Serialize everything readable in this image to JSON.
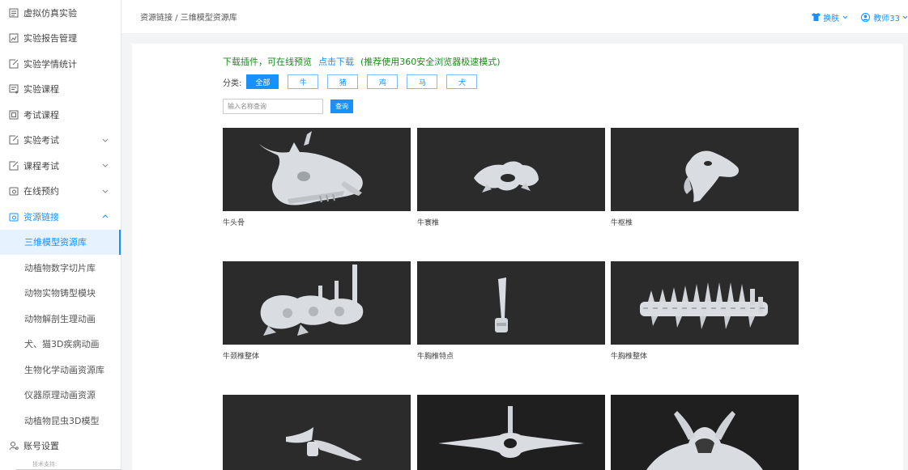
{
  "sidebar": {
    "items": [
      {
        "label": "虚拟仿真实验",
        "icon": "list-icon"
      },
      {
        "label": "实验报告管理",
        "icon": "report-icon"
      },
      {
        "label": "实验学情统计",
        "icon": "edit-icon"
      },
      {
        "label": "实验课程",
        "icon": "course-icon"
      },
      {
        "label": "考试课程",
        "icon": "exam-icon"
      },
      {
        "label": "实验考试",
        "icon": "edit-icon",
        "expandable": true
      },
      {
        "label": "课程考试",
        "icon": "edit-icon",
        "expandable": true
      },
      {
        "label": "在线预约",
        "icon": "calendar-icon",
        "expandable": true
      },
      {
        "label": "资源链接",
        "icon": "link-icon",
        "expandable": true,
        "open": true
      }
    ],
    "sub_items": [
      {
        "label": "三维模型资源库",
        "active": true
      },
      {
        "label": "动植物数字切片库"
      },
      {
        "label": "动物实物铸型模块"
      },
      {
        "label": "动物解剖生理动画"
      },
      {
        "label": "犬、猫3D疾病动画"
      },
      {
        "label": "生物化学动画资源库"
      },
      {
        "label": "仪器原理动画资源"
      },
      {
        "label": "动植物昆虫3D模型"
      }
    ],
    "account": "账号设置",
    "footer_note": "技术支持:"
  },
  "header": {
    "breadcrumb": "资源链接 / 三维模型资源库",
    "skin_label": "换肤",
    "user_label": "教师33"
  },
  "main": {
    "notice_text": "下载插件，可在线预览",
    "notice_link": "点击下载",
    "notice_tip": "(推荐使用360安全浏览器极速模式)",
    "filter_label": "分类:",
    "categories": [
      "全部",
      "牛",
      "猪",
      "鸡",
      "马",
      "犬"
    ],
    "active_category": "全部",
    "search_placeholder": "输入名称查询",
    "search_button": "查询",
    "models": [
      {
        "name": "牛头骨"
      },
      {
        "name": "牛寰椎"
      },
      {
        "name": "牛枢椎"
      },
      {
        "name": "牛颈椎整体"
      },
      {
        "name": "牛胸椎特点"
      },
      {
        "name": "牛胸椎整体"
      },
      {
        "name": ""
      },
      {
        "name": ""
      },
      {
        "name": ""
      }
    ]
  },
  "colors": {
    "accent": "#1890ff",
    "notice_green": "#1b8a1b",
    "thumb_bg": "#2b2b2b",
    "bone": "#d9dde2"
  }
}
